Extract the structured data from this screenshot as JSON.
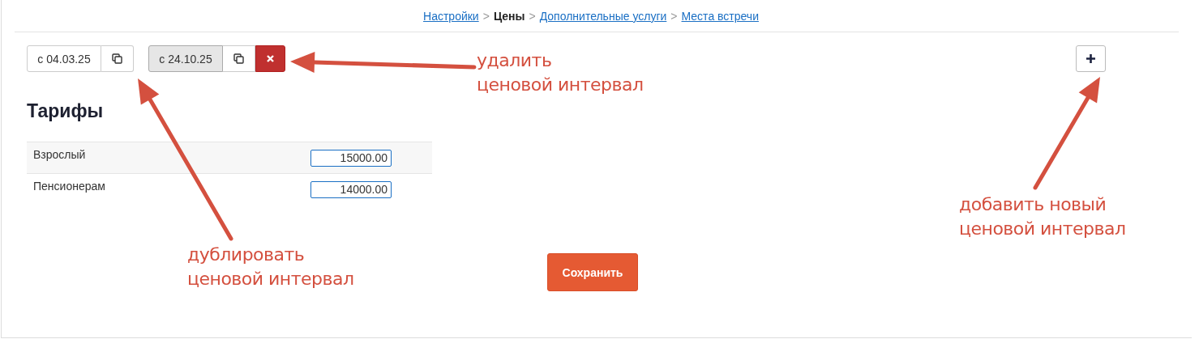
{
  "breadcrumbs": [
    {
      "label": "Настройки",
      "kind": "link"
    },
    {
      "label": ">",
      "kind": "separator"
    },
    {
      "label": "Цены",
      "kind": "current"
    },
    {
      "label": ">",
      "kind": "separator"
    },
    {
      "label": "Дополнительные услуги",
      "kind": "link"
    },
    {
      "label": ">",
      "kind": "separator"
    },
    {
      "label": "Места встречи",
      "kind": "link"
    }
  ],
  "intervals": [
    {
      "label": "с 04.03.25",
      "selected": false,
      "deletable": false
    },
    {
      "label": "с 24.10.25",
      "selected": true,
      "deletable": true
    }
  ],
  "title": "Тарифы",
  "tariffs": [
    {
      "name": "Взрослый",
      "value": "15000.00"
    },
    {
      "name": "Пенсионерам",
      "value": "14000.00"
    }
  ],
  "save_button": "Сохранить",
  "annotations": [
    {
      "text": "удалить\nценовой интервал",
      "kind": "delete"
    },
    {
      "text": "дублировать\nценовой интервал",
      "kind": "copy"
    },
    {
      "text": "добавить новый\nценовой интервал",
      "kind": "add"
    }
  ]
}
